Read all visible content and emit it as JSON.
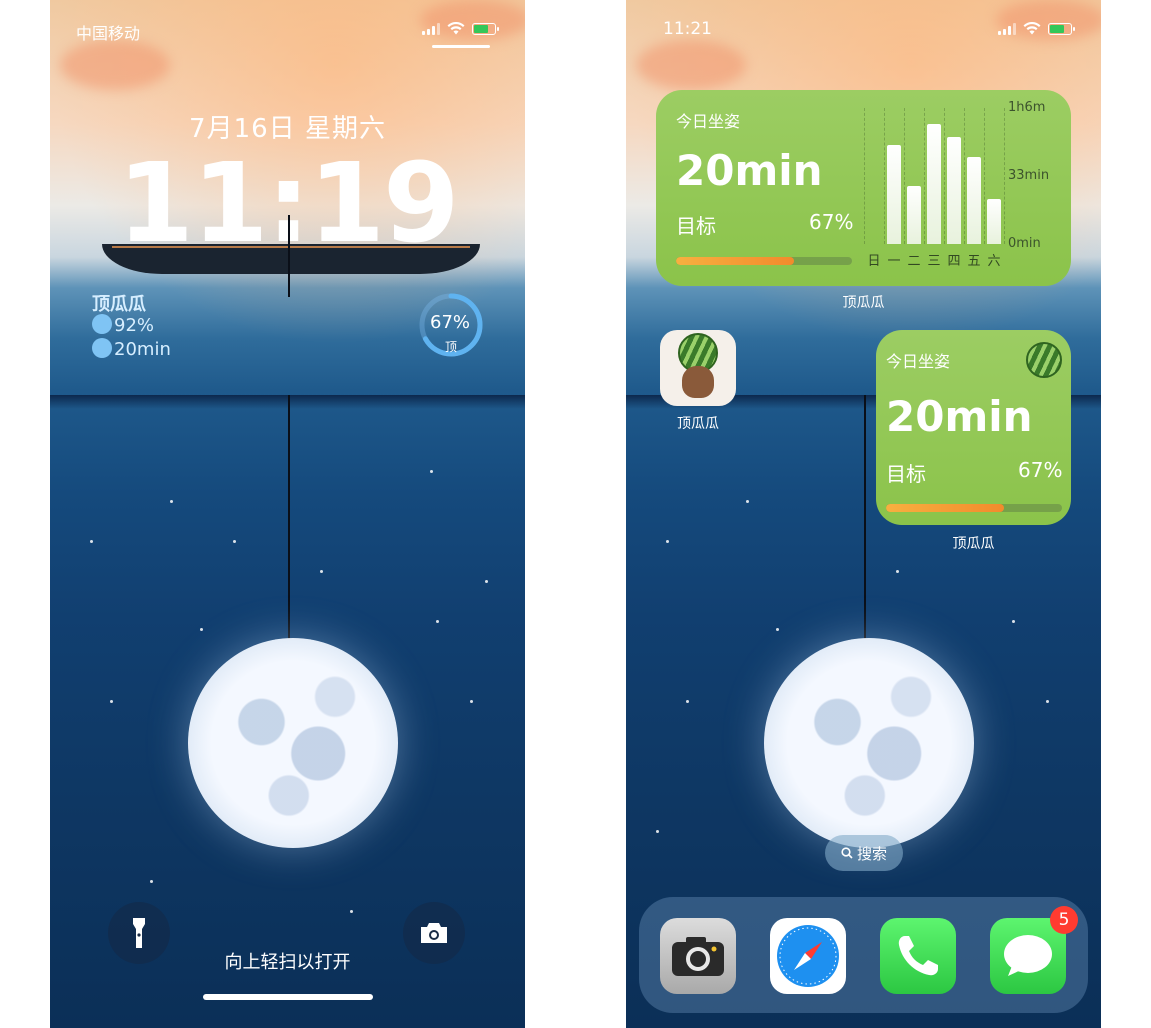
{
  "left_phone": {
    "status": {
      "carrier": "中国移动"
    },
    "lock": {
      "date": "7月16日 星期六",
      "time": "11:19",
      "widget": {
        "name": "顶瓜瓜",
        "stat1": "92%",
        "stat2": "20min"
      },
      "ring": {
        "percent_text": "67%",
        "sub": "顶",
        "value": 0.67
      },
      "swipe_hint": "向上轻扫以打开"
    },
    "icons": {
      "flashlight": "flashlight-icon",
      "camera": "camera-icon"
    }
  },
  "right_phone": {
    "status": {
      "time": "11:21"
    },
    "large_widget": {
      "title": "今日坐姿",
      "value": "20min",
      "goal_label": "目标",
      "goal_pct": "67%",
      "progress": 0.67,
      "app_label": "顶瓜瓜",
      "chart_data": {
        "type": "bar",
        "categories": [
          "日",
          "一",
          "二",
          "三",
          "四",
          "五",
          "六"
        ],
        "values": [
          0,
          48,
          28,
          58,
          52,
          42,
          22
        ],
        "ytick_labels": [
          "1h6m",
          "33min",
          "0min"
        ],
        "ylim": [
          0,
          66
        ]
      }
    },
    "app": {
      "label": "顶瓜瓜"
    },
    "small_widget": {
      "title": "今日坐姿",
      "value": "20min",
      "goal_label": "目标",
      "goal_pct": "67%",
      "progress": 0.67,
      "app_label": "顶瓜瓜"
    },
    "search": {
      "label": "搜索"
    },
    "dock": {
      "apps": [
        "Camera",
        "Safari",
        "Phone",
        "Messages"
      ],
      "messages_badge": "5"
    }
  },
  "colors": {
    "widget_green": "#8bc34a",
    "progress_orange": "#f28b2c",
    "badge_red": "#ff3b30"
  }
}
